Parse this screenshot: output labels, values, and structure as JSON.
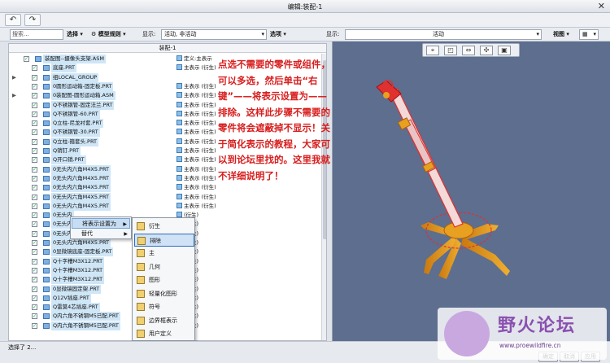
{
  "window": {
    "title": "编辑:装配-1"
  },
  "filter_bar": {
    "search_placeholder": "搜索...",
    "select_label": "选择",
    "rules_label": "模型规则",
    "display_label": "显示:",
    "display_value": "活动, 非活动",
    "options_label": "选项",
    "right_display_label": "显示:",
    "right_display_value": "活动",
    "view_label": "视图"
  },
  "tree": {
    "header": "装配-1",
    "rows": [
      {
        "exp": "",
        "check": true,
        "indent": 0,
        "name": "装配图--摄像头支架.ASM",
        "status": "定义:主表示"
      },
      {
        "exp": "",
        "check": true,
        "indent": 1,
        "name": "底座.PRT",
        "status": "主表示  (衍生)"
      },
      {
        "exp": "▶",
        "check": true,
        "indent": 1,
        "name": "组LOCAL_GROUP",
        "status": ""
      },
      {
        "exp": "",
        "check": true,
        "indent": 1,
        "name": "0圆形运动箱-固定板.PRT",
        "status": "主表示  (衍生)"
      },
      {
        "exp": "▶",
        "check": true,
        "indent": 1,
        "name": "0装配图-圆形运动箱.ASM",
        "status": "主表示  (衍生)"
      },
      {
        "exp": "",
        "check": true,
        "indent": 1,
        "name": "Q不锈钢管-固定法兰.PRT",
        "status": "主表示  (衍生)"
      },
      {
        "exp": "",
        "check": true,
        "indent": 1,
        "name": "Q不锈钢管-60.PRT",
        "status": "主表示  (衍生)"
      },
      {
        "exp": "",
        "check": true,
        "indent": 1,
        "name": "Q立柱-尼龙衬套.PRT",
        "status": "主表示  (衍生)"
      },
      {
        "exp": "",
        "check": true,
        "indent": 1,
        "name": "Q不锈钢管-30.PRT",
        "status": "主表示  (衍生)"
      },
      {
        "exp": "",
        "check": true,
        "indent": 1,
        "name": "Q立柱-箍套头.PRT",
        "status": "主表示  (衍生)"
      },
      {
        "exp": "",
        "check": true,
        "indent": 1,
        "name": "Q销钉.PRT",
        "status": "主表示  (衍生)"
      },
      {
        "exp": "",
        "check": true,
        "indent": 1,
        "name": "Q开口销.PRT",
        "status": "主表示  (衍生)"
      },
      {
        "exp": "",
        "check": true,
        "indent": 1,
        "name": "0无头内六角M4X5.PRT",
        "status": "主表示  (衍生)"
      },
      {
        "exp": "",
        "check": true,
        "indent": 1,
        "name": "0无头内六角M4X5.PRT",
        "status": "主表示  (衍生)"
      },
      {
        "exp": "",
        "check": true,
        "indent": 1,
        "name": "0无头内六角M4X5.PRT",
        "status": "主表示  (衍生)"
      },
      {
        "exp": "",
        "check": true,
        "indent": 1,
        "name": "0无头内六角M4X5.PRT",
        "status": "主表示  (衍生)"
      },
      {
        "exp": "",
        "check": true,
        "indent": 1,
        "name": "0无头内六角M4X5.PRT",
        "status": "主表示  (衍生)"
      },
      {
        "exp": "",
        "check": true,
        "indent": 1,
        "name": "0无头内",
        "status": "(衍生)"
      },
      {
        "exp": "",
        "check": true,
        "indent": 1,
        "name": "0无头内",
        "status": "(衍生)"
      },
      {
        "exp": "",
        "check": true,
        "indent": 1,
        "name": "0无头内",
        "status": "(衍生)"
      },
      {
        "exp": "",
        "check": true,
        "indent": 1,
        "name": "0无头内六角M4X5.PRT",
        "status": "(衍生)"
      },
      {
        "exp": "",
        "check": true,
        "indent": 1,
        "name": "0显微镜底座-固定板.PRT",
        "status": "(衍生)"
      },
      {
        "exp": "",
        "check": true,
        "indent": 1,
        "name": "Q十字槽M3X12.PRT",
        "status": "(衍生)"
      },
      {
        "exp": "",
        "check": true,
        "indent": 1,
        "name": "Q十字槽M3X12.PRT",
        "status": "(衍生)"
      },
      {
        "exp": "",
        "check": true,
        "indent": 1,
        "name": "Q十字槽M3X12.PRT",
        "status": "(衍生)"
      },
      {
        "exp": "",
        "check": true,
        "indent": 1,
        "name": "0显微镜固定架.PRT",
        "status": "(衍生)"
      },
      {
        "exp": "",
        "check": true,
        "indent": 1,
        "name": "Q12V插座.PRT",
        "status": "(衍生)"
      },
      {
        "exp": "",
        "check": true,
        "indent": 1,
        "name": "Q雷莫4芯插座.PRT",
        "status": "(衍生)"
      },
      {
        "exp": "",
        "check": true,
        "indent": 1,
        "name": "Q内六角不锈钢M5已配.PRT",
        "status": "(衍生)"
      },
      {
        "exp": "",
        "check": true,
        "indent": 1,
        "name": "Q内六角不锈钢M5已配.PRT",
        "status": "(衍生)"
      }
    ]
  },
  "context_menu": {
    "items": [
      {
        "label": "将表示设置为",
        "has_sub": true,
        "highlight": true
      },
      {
        "label": "替代",
        "has_sub": true,
        "highlight": false
      }
    ]
  },
  "submenu": {
    "items": [
      {
        "label": "衍生",
        "icon": "derived-icon",
        "highlight": false
      },
      {
        "label": "排除",
        "icon": "exclude-icon",
        "highlight": true
      },
      {
        "label": "主",
        "icon": "master-icon",
        "highlight": false
      },
      {
        "label": "几何",
        "icon": "geometry-icon",
        "highlight": false
      },
      {
        "label": "图形",
        "icon": "graphics-icon",
        "highlight": false
      },
      {
        "label": "轻量化图形",
        "icon": "lightweight-graphics-icon",
        "highlight": false
      },
      {
        "label": "符号",
        "icon": "symbolic-icon",
        "highlight": false
      },
      {
        "label": "边界框表示",
        "icon": "bounding-box-icon",
        "highlight": false
      },
      {
        "label": "用户定义",
        "icon": "user-defined-icon",
        "highlight": false
      }
    ]
  },
  "annotation": {
    "text": "点选不需要的零件或组件，可以多选，然后单击“右键”——将表示设置为——排除。这样此步骤不需要的零件将会遮蔽掉不显示！关于简化表示的教程，大家可以到论坛里找的。这里我就不详细说明了！"
  },
  "status_bar": {
    "message": "选择了 2...",
    "ok_label": "确定",
    "cancel_label": "取消",
    "apply_label": "应用"
  },
  "watermark": {
    "title": "野火论坛",
    "url": "www.proewildfire.cn"
  },
  "colors": {
    "annotation": "#d81e1e",
    "viewport": "#5d6e8f",
    "model_orange": "#e8a020",
    "model_red": "#e03030"
  }
}
